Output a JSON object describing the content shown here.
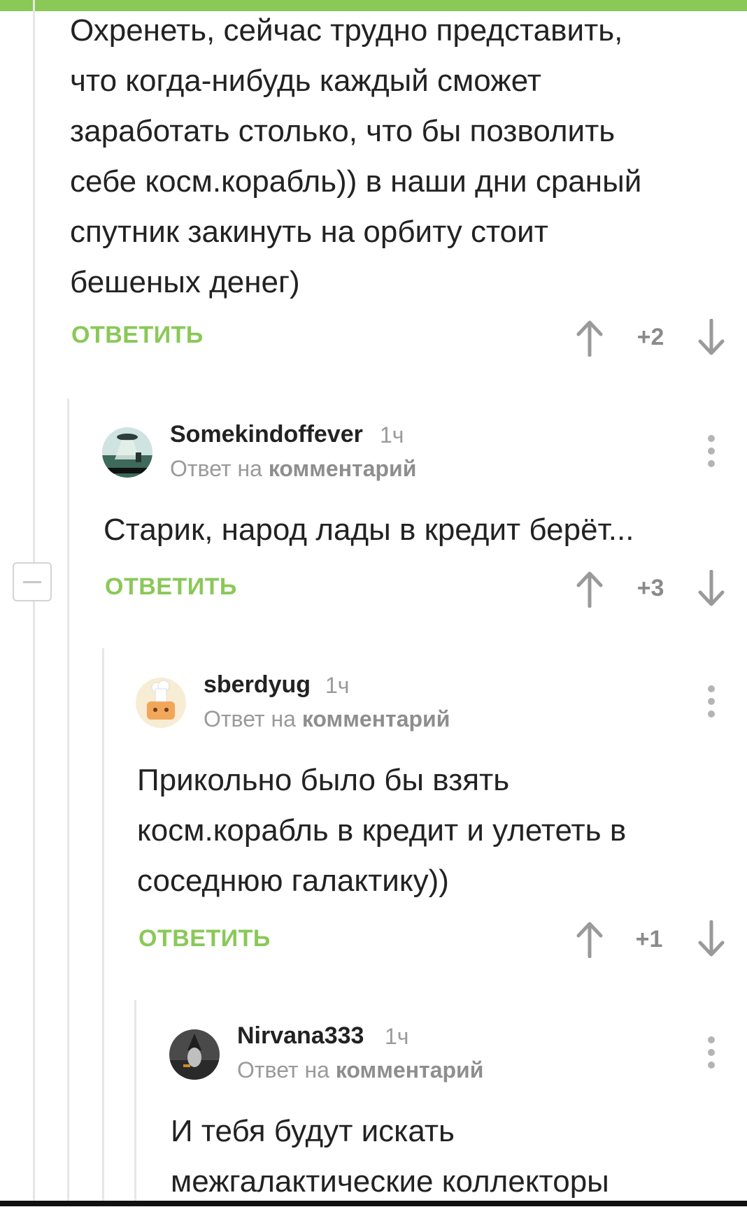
{
  "comment0": {
    "text_lines": [
      "Охренеть, сейчас трудно представить,",
      "что когда-нибудь каждый сможет",
      "заработать столько, что бы позволить",
      "себе косм.корабль)) в наши дни сраный",
      "спутник закинуть на орбиту стоит",
      "бешеных денег)"
    ],
    "reply_label": "ОТВЕТИТЬ",
    "score": "+2"
  },
  "comment1": {
    "username": "Somekindoffever",
    "time": "1ч",
    "reply_to_prefix": "Ответ на",
    "reply_to_link": "комментарий",
    "text_lines": [
      "Старик, народ лады в кредит берёт..."
    ],
    "reply_label": "ОТВЕТИТЬ",
    "score": "+3"
  },
  "comment2": {
    "username": "sberdyug",
    "time": "1ч",
    "reply_to_prefix": "Ответ на",
    "reply_to_link": "комментарий",
    "text_lines": [
      "Прикольно было бы взять",
      "косм.корабль в кредит и улететь в",
      "соседнюю галактику))"
    ],
    "reply_label": "ОТВЕТИТЬ",
    "score": "+1"
  },
  "comment3": {
    "username": "Nirvana333",
    "time": "1ч",
    "reply_to_prefix": "Ответ на",
    "reply_to_link": "комментарий",
    "text_lines": [
      "И тебя будут искать",
      "межгалактические коллекторы"
    ]
  },
  "icons": {
    "upvote": "arrow-up-icon",
    "downvote": "arrow-down-icon",
    "more": "more-vertical-icon",
    "collapse": "minus-square-icon"
  },
  "colors": {
    "accent_green": "#8ac858",
    "text": "#222222",
    "muted": "#9a9a9a",
    "thread_line": "#e6e6e6"
  }
}
